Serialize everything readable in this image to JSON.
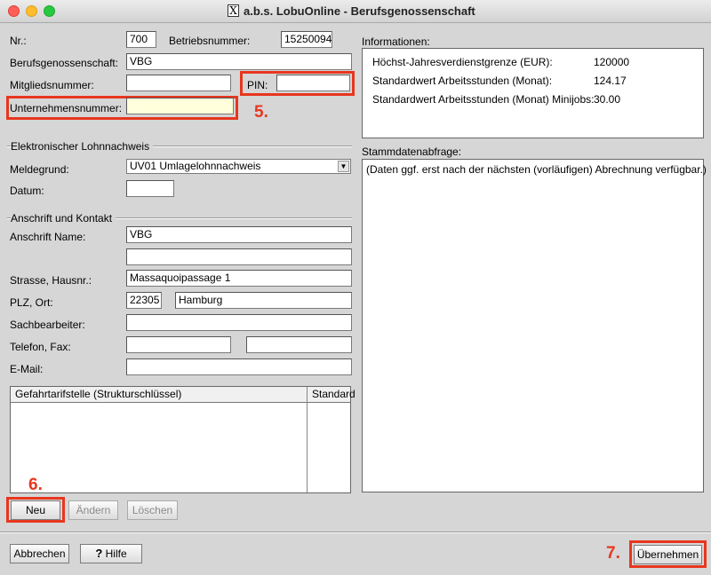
{
  "window": {
    "title": "a.b.s. LobuOnline - Berufsgenossenschaft",
    "title_icon": "X"
  },
  "form": {
    "nr": {
      "label": "Nr.:",
      "value": "700"
    },
    "betriebsnummer": {
      "label": "Betriebsnummer:",
      "value": "15250094"
    },
    "berufsgenossenschaft": {
      "label": "Berufsgenossenschaft:",
      "value": "VBG"
    },
    "mitgliedsnummer": {
      "label": "Mitgliedsnummer:",
      "value": ""
    },
    "pin": {
      "label": "PIN:",
      "value": ""
    },
    "unternehmensnummer": {
      "label": "Unternehmensnummer:",
      "value": ""
    }
  },
  "lohnnachweis": {
    "section_title": "Elektronischer Lohnnachweis",
    "meldegrund": {
      "label": "Meldegrund:",
      "value": "UV01 Umlagelohnnachweis"
    },
    "datum": {
      "label": "Datum:",
      "value": ""
    }
  },
  "anschrift": {
    "section_title": "Anschrift und Kontakt",
    "name": {
      "label": "Anschrift Name:",
      "value1": "VBG",
      "value2": ""
    },
    "strasse": {
      "label": "Strasse, Hausnr.:",
      "value": "Massaquoipassage 1"
    },
    "plz_ort": {
      "label": "PLZ, Ort:",
      "plz": "22305",
      "ort": "Hamburg"
    },
    "sachbearbeiter": {
      "label": "Sachbearbeiter:",
      "value": ""
    },
    "telefon_fax": {
      "label": "Telefon, Fax:",
      "telefon": "",
      "fax": ""
    },
    "email": {
      "label": "E-Mail:",
      "value": ""
    }
  },
  "table": {
    "columns": [
      "Gefahrtarifstelle (Strukturschlüssel)",
      "Standard"
    ],
    "rows": []
  },
  "table_buttons": {
    "neu": "Neu",
    "aendern": "Ändern",
    "loeschen": "Löschen"
  },
  "info": {
    "title": "Informationen:",
    "rows": [
      {
        "label": "Höchst-Jahresverdienstgrenze (EUR):",
        "value": "120000"
      },
      {
        "label": "Standardwert Arbeitsstunden (Monat):",
        "value": "124.17"
      },
      {
        "label": "Standardwert Arbeitsstunden (Monat) Minijobs:",
        "value": "30.00"
      }
    ]
  },
  "stammdaten": {
    "title": "Stammdatenabfrage:",
    "text": "(Daten ggf. erst nach der nächsten (vorläufigen) Abrechnung verfügbar.)"
  },
  "footer": {
    "abbrechen": "Abbrechen",
    "hilfe": "Hilfe",
    "hilfe_icon": "?",
    "uebernehmen": "Übernehmen"
  },
  "annotations": {
    "a5": "5.",
    "a6": "6.",
    "a7": "7."
  },
  "colors": {
    "highlight": "#e8361e",
    "required_field": "#ffffdc"
  }
}
